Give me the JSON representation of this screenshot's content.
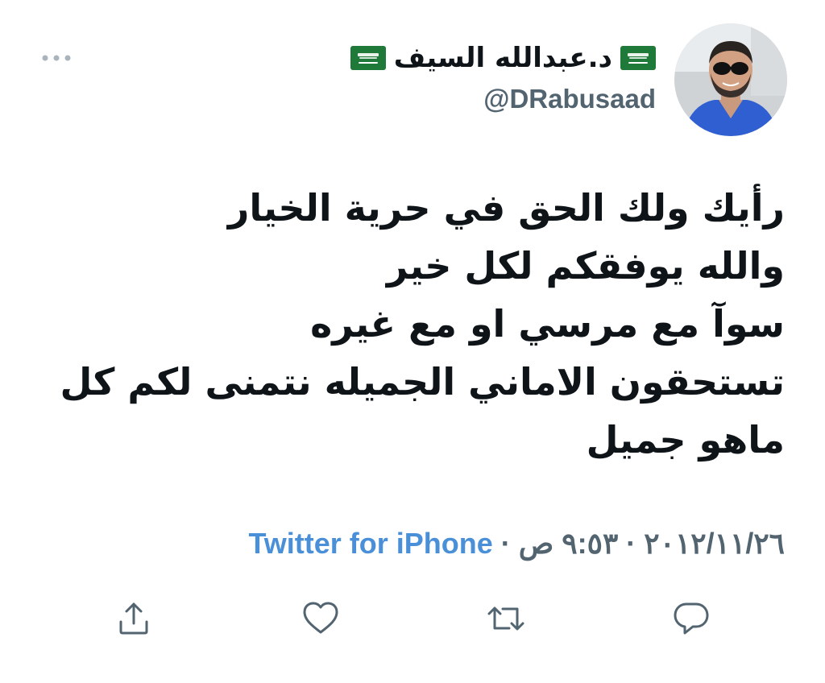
{
  "tweet": {
    "author": {
      "display_name": "د.عبدالله السيف",
      "handle": "@DRabusaad"
    },
    "text_lines": [
      "رأيك ولك الحق في حرية الخيار",
      "والله يوفقكم لكل خير",
      "سوآ مع مرسي او مع غيره",
      "تستحقون الاماني الجميله نتمنى لكم كل",
      "ماهو جميل"
    ],
    "date": "٢٠١٢/١١/٢٦",
    "time": "٩:٥٣ ص",
    "separator": "·",
    "source": "Twitter for iPhone"
  },
  "icons": {
    "more": "more-horizontal-icon",
    "flag": "saudi-flag-icon",
    "share": "share-icon",
    "like": "heart-icon",
    "retweet": "retweet-icon",
    "reply": "reply-icon"
  },
  "colors": {
    "text": "#0f1419",
    "secondary": "#536471",
    "link": "#4a90d9",
    "flag_green": "#1f7a3a"
  }
}
